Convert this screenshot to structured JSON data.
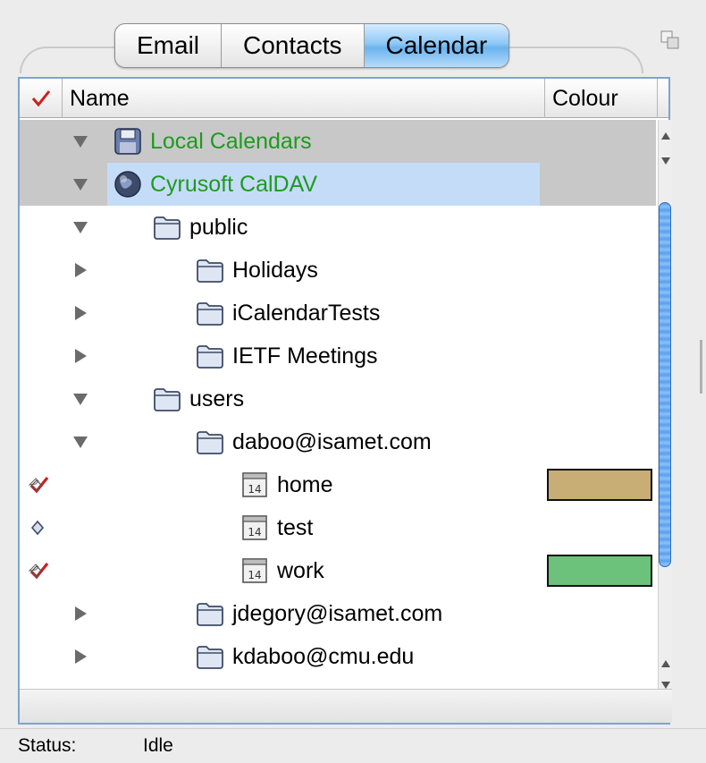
{
  "tabs": [
    {
      "label": "Email",
      "selected": false
    },
    {
      "label": "Contacts",
      "selected": false
    },
    {
      "label": "Calendar",
      "selected": true
    }
  ],
  "columns": {
    "check": "✓",
    "name": "Name",
    "colour": "Colour"
  },
  "rows": [
    {
      "label": "Local Calendars",
      "depth": 0,
      "expanded": true,
      "type": "group",
      "icon": "disk-icon",
      "green": true
    },
    {
      "label": "Cyrusoft CalDAV",
      "depth": 0,
      "expanded": true,
      "type": "group",
      "icon": "globe-icon",
      "green": true,
      "highlight": true
    },
    {
      "label": "public",
      "depth": 1,
      "expanded": true,
      "type": "folder",
      "icon": "folder-icon"
    },
    {
      "label": "Holidays",
      "depth": 2,
      "expanded": false,
      "type": "folder",
      "icon": "folder-icon"
    },
    {
      "label": "iCalendarTests",
      "depth": 2,
      "expanded": false,
      "type": "folder",
      "icon": "folder-icon"
    },
    {
      "label": "IETF Meetings",
      "depth": 2,
      "expanded": false,
      "type": "folder",
      "icon": "folder-icon"
    },
    {
      "label": "users",
      "depth": 1,
      "expanded": true,
      "type": "folder",
      "icon": "folder-icon"
    },
    {
      "label": "daboo@isamet.com",
      "depth": 2,
      "expanded": true,
      "type": "folder",
      "icon": "folder-icon"
    },
    {
      "label": "home",
      "depth": 3,
      "type": "calendar",
      "icon": "calendar-icon",
      "checked": true,
      "colour": "#c8ad74"
    },
    {
      "label": "test",
      "depth": 3,
      "type": "calendar",
      "icon": "calendar-icon",
      "checked": false
    },
    {
      "label": "work",
      "depth": 3,
      "type": "calendar",
      "icon": "calendar-icon",
      "checked": true,
      "colour": "#6cc27a"
    },
    {
      "label": "jdegory@isamet.com",
      "depth": 2,
      "expanded": false,
      "type": "folder",
      "icon": "folder-icon"
    },
    {
      "label": "kdaboo@cmu.edu",
      "depth": 2,
      "expanded": false,
      "type": "folder",
      "icon": "folder-icon"
    }
  ],
  "calendar_icon_text": "14",
  "status": {
    "label": "Status:",
    "value": "Idle"
  },
  "colors": {
    "accent": "#6bb3ee",
    "green_text": "#1f9a1f",
    "check_red": "#cc2020"
  }
}
